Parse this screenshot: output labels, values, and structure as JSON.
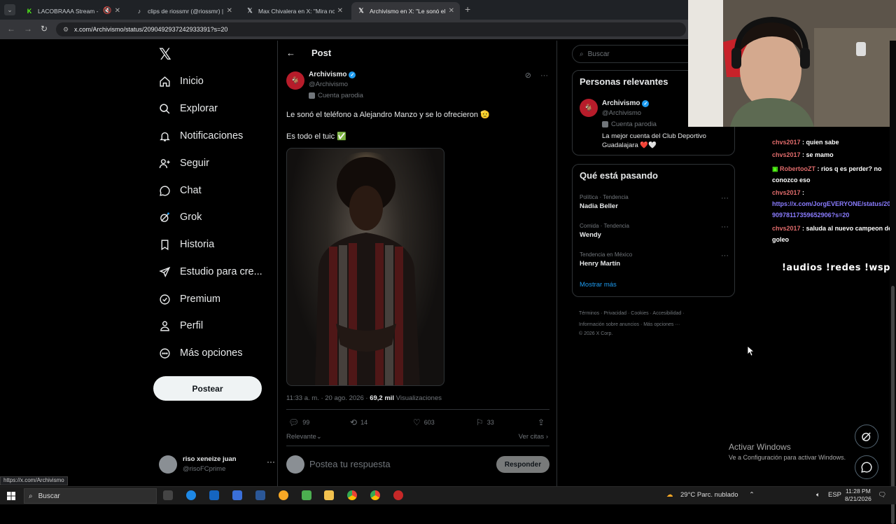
{
  "browser": {
    "tabs": [
      {
        "title": "LACOBRAAA Stream - Wat",
        "icon": "kick-icon",
        "color": "#53fc18"
      },
      {
        "title": "clips de riossmr (@riossmr) |",
        "icon": "tiktok-icon",
        "color": "#ffffff"
      },
      {
        "title": "Max Chivalera en X: \"Mira nom",
        "icon": "x-icon",
        "color": "#ffffff"
      },
      {
        "title": "Archivismo en X: \"Le sonó el tel",
        "icon": "x-icon",
        "color": "#ffffff"
      }
    ],
    "url": "x.com/Archivismo/status/2090492937242933391?s=20",
    "status_url": "https://x.com/Archivismo"
  },
  "sidebar": {
    "items": [
      {
        "label": "Inicio",
        "icon": "home-icon"
      },
      {
        "label": "Explorar",
        "icon": "search-icon"
      },
      {
        "label": "Notificaciones",
        "icon": "bell-icon"
      },
      {
        "label": "Seguir",
        "icon": "add-user-icon"
      },
      {
        "label": "Chat",
        "icon": "chat-icon"
      },
      {
        "label": "Grok",
        "icon": "grok-icon"
      },
      {
        "label": "Historia",
        "icon": "bookmark-icon"
      },
      {
        "label": "Estudio para cre...",
        "icon": "rocket-icon"
      },
      {
        "label": "Premium",
        "icon": "verified-icon"
      },
      {
        "label": "Perfil",
        "icon": "person-icon"
      },
      {
        "label": "Más opciones",
        "icon": "more-circle-icon"
      }
    ],
    "post_button": "Postear",
    "account": {
      "name": "riso xeneize juan",
      "handle": "@risoFCprime"
    }
  },
  "post": {
    "header": "Post",
    "author": {
      "name": "Archivismo",
      "handle": "@Archivismo",
      "badge": "Cuenta parodia"
    },
    "text_line1": "Le sonó el teléfono a Alejandro Manzo y se lo ofrecieron 🫡",
    "text_line2": "Es todo el tuic ✅",
    "time": "11:33 a. m. · 20 ago. 2026 · ",
    "views_count": "69,2 mil",
    "views_label": " Visualizaciones",
    "stats": {
      "replies": "99",
      "reposts": "14",
      "likes": "603",
      "bookmarks": "33"
    },
    "sort": "Relevante",
    "quotes": "Ver citas",
    "reply_placeholder": "Postea tu respuesta",
    "reply_button": "Responder"
  },
  "right": {
    "search_placeholder": "Buscar",
    "relevant_title": "Personas relevantes",
    "relevant": {
      "name": "Archivismo",
      "handle": "@Archivismo",
      "badge": "Cuenta parodia",
      "bio": "La mejor cuenta del Club Deportivo Guadalajara ❤️🤍"
    },
    "trends_title": "Qué está pasando",
    "trends": [
      {
        "category": "Política · Tendencia",
        "name": "Nadia Beller"
      },
      {
        "category": "Comida · Tendencia",
        "name": "Wendy"
      },
      {
        "category": "Tendencia en México",
        "name": "Henry Martín"
      }
    ],
    "show_more": "Mostrar más",
    "footer_line1": "Términos · Privacidad · Cookies · Accesibilidad ·",
    "footer_line2": "Información sobre anuncios · Más opciones ···",
    "footer_line3": "© 2026 X Corp."
  },
  "stream_chat": {
    "messages": [
      {
        "user": "chvs2017",
        "text": " : quien sabe"
      },
      {
        "user": "chvs2017",
        "text": " : se mamo"
      },
      {
        "user": "RobertooZT",
        "text": " : rios q es perder? no conozco eso"
      },
      {
        "user": "chvs2017",
        "text": " : "
      },
      {
        "link": "https://x.com/JorgEVERYONE/status/2090978117359652906?s=20"
      },
      {
        "user": "chvs2017",
        "text": " : saluda al nuevo campeon de goleo"
      }
    ],
    "commands": "!audios !redes !wsp"
  },
  "windows": {
    "activate_title": "Activar Windows",
    "activate_sub": "Ve a Configuración para activar Windows.",
    "search": "Buscar",
    "weather": "29°C  Parc. nublado",
    "lang": "ESP",
    "time": "11:28 PM",
    "date": "8/21/2026"
  },
  "colors": {
    "accent": "#1d9bf0",
    "background": "#000000",
    "text": "#e7e9ea",
    "muted": "#71767b",
    "border": "#2f3336"
  }
}
